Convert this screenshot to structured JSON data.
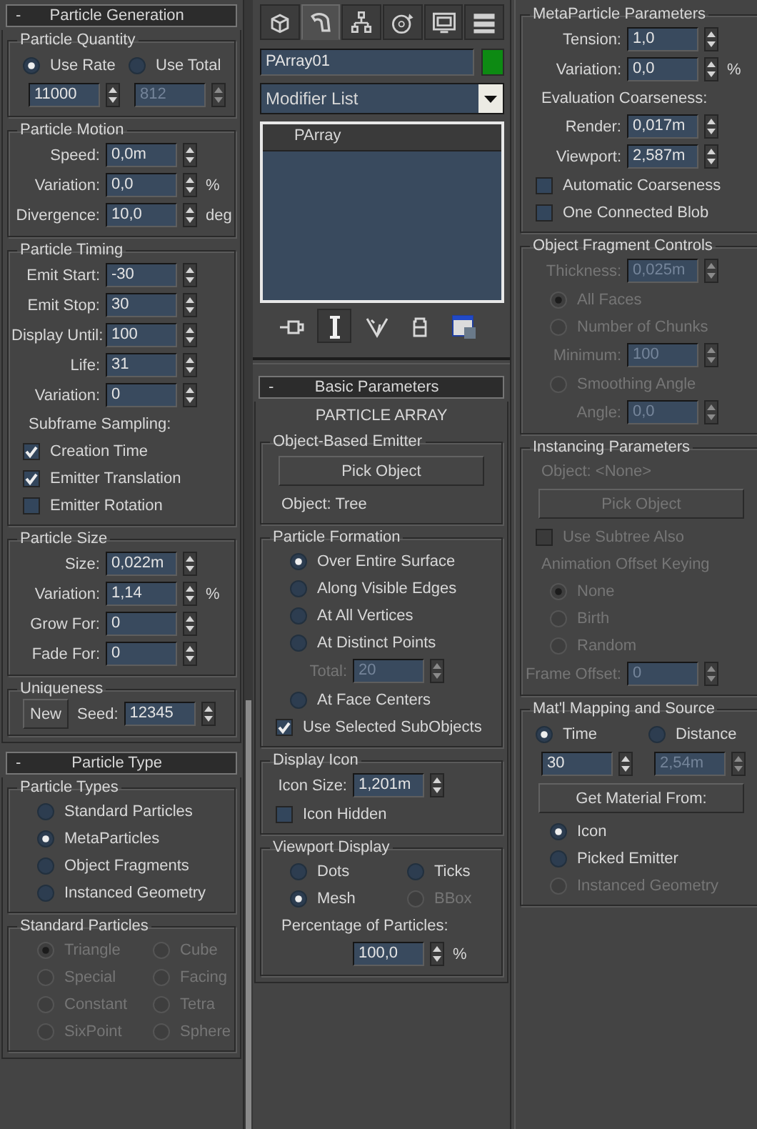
{
  "left_panel": {
    "rollouts": [
      {
        "toggle": "-",
        "title": "Particle Generation",
        "groups": [
          {
            "title": "Particle Quantity",
            "rows": [
              {
                "kind": "row",
                "items": [
                  {
                    "kind": "radio",
                    "label": "Use Rate",
                    "selected": true,
                    "disabled": false
                  },
                  {
                    "kind": "radio",
                    "label": "Use Total",
                    "selected": false,
                    "disabled": false
                  }
                ]
              },
              {
                "kind": "row",
                "items": [
                  {
                    "kind": "spinner",
                    "value": "11000",
                    "disabled": false
                  },
                  {
                    "kind": "spinner",
                    "value": "812",
                    "disabled": true
                  }
                ]
              }
            ]
          },
          {
            "title": "Particle Motion",
            "rows": [
              {
                "kind": "spinner",
                "label": "Speed:",
                "value": "0,0m",
                "disabled": false
              },
              {
                "kind": "spinner",
                "label": "Variation:",
                "value": "0,0",
                "unit": "%",
                "disabled": false
              },
              {
                "kind": "spinner",
                "label": "Divergence:",
                "value": "10,0",
                "unit": "deg",
                "disabled": false
              }
            ]
          },
          {
            "title": "Particle Timing",
            "rows": [
              {
                "kind": "spinner",
                "label": "Emit Start:",
                "value": "-30",
                "disabled": false
              },
              {
                "kind": "spinner",
                "label": "Emit Stop:",
                "value": "30",
                "disabled": false
              },
              {
                "kind": "spinner",
                "label": "Display Until:",
                "value": "100",
                "disabled": false
              },
              {
                "kind": "spinner",
                "label": "Life:",
                "value": "31",
                "disabled": false
              },
              {
                "kind": "spinner",
                "label": "Variation:",
                "value": "0",
                "disabled": false
              },
              {
                "kind": "note",
                "text": "Subframe Sampling:",
                "disabled": false
              },
              {
                "kind": "check",
                "label": "Creation Time",
                "checked": true,
                "disabled": false
              },
              {
                "kind": "check",
                "label": "Emitter Translation",
                "checked": true,
                "disabled": false
              },
              {
                "kind": "check",
                "label": "Emitter Rotation",
                "checked": false,
                "disabled": false
              }
            ]
          },
          {
            "title": "Particle Size",
            "rows": [
              {
                "kind": "spinner",
                "label": "Size:",
                "value": "0,022m",
                "disabled": false
              },
              {
                "kind": "spinner",
                "label": "Variation:",
                "value": "1,14",
                "unit": "%",
                "disabled": false
              },
              {
                "kind": "spinner",
                "label": "Grow For:",
                "value": "0",
                "disabled": false
              },
              {
                "kind": "spinner",
                "label": "Fade For:",
                "value": "0",
                "disabled": false
              }
            ]
          },
          {
            "title": "Uniqueness",
            "rows": [
              {
                "kind": "row",
                "items": [
                  {
                    "kind": "button",
                    "label": "New",
                    "disabled": false
                  },
                  {
                    "kind": "spinner",
                    "label": "Seed:",
                    "value": "12345",
                    "disabled": false
                  }
                ]
              }
            ]
          }
        ]
      },
      {
        "toggle": "-",
        "title": "Particle Type",
        "groups": [
          {
            "title": "Particle Types",
            "rows": [
              {
                "kind": "radio",
                "label": "Standard Particles",
                "selected": false,
                "disabled": false
              },
              {
                "kind": "radio",
                "label": "MetaParticles",
                "selected": true,
                "disabled": false
              },
              {
                "kind": "radio",
                "label": "Object Fragments",
                "selected": false,
                "disabled": false
              },
              {
                "kind": "radio",
                "label": "Instanced Geometry",
                "selected": false,
                "disabled": false
              }
            ]
          },
          {
            "title": "Standard Particles",
            "rows": [
              {
                "kind": "grid",
                "items": [
                  {
                    "kind": "radio",
                    "label": "Triangle",
                    "selected": true,
                    "disabled": true
                  },
                  {
                    "kind": "radio",
                    "label": "Cube",
                    "selected": false,
                    "disabled": true
                  },
                  {
                    "kind": "radio",
                    "label": "Special",
                    "selected": false,
                    "disabled": true
                  },
                  {
                    "kind": "radio",
                    "label": "Facing",
                    "selected": false,
                    "disabled": true
                  },
                  {
                    "kind": "radio",
                    "label": "Constant",
                    "selected": false,
                    "disabled": true
                  },
                  {
                    "kind": "radio",
                    "label": "Tetra",
                    "selected": false,
                    "disabled": true
                  },
                  {
                    "kind": "radio",
                    "label": "SixPoint",
                    "selected": false,
                    "disabled": true
                  },
                  {
                    "kind": "radio",
                    "label": "Sphere",
                    "selected": false,
                    "disabled": true
                  }
                ]
              }
            ]
          }
        ]
      }
    ]
  },
  "command_tabs": [
    {
      "selected": false
    },
    {
      "selected": true
    },
    {
      "selected": false
    },
    {
      "selected": false
    },
    {
      "selected": false
    },
    {
      "selected": false
    }
  ],
  "object_name": "PArray01",
  "modifier_list": "Modifier List",
  "modifier_stack": [
    {
      "label": "PArray",
      "selected": true
    }
  ],
  "stack_toolbar": [
    {
      "on": false
    },
    {
      "on": true
    },
    {
      "on": false
    },
    {
      "on": false
    },
    {
      "on": false
    }
  ],
  "middle_panel": {
    "rollouts": [
      {
        "toggle": "-",
        "title": "Basic Parameters",
        "heading": "PARTICLE ARRAY",
        "groups": [
          {
            "title": "Object-Based Emitter",
            "rows": [
              {
                "kind": "button",
                "label": "Pick Object",
                "disabled": false
              },
              {
                "kind": "note",
                "text": "Object: Tree",
                "disabled": false
              }
            ]
          },
          {
            "title": "Particle Formation",
            "rows": [
              {
                "kind": "radio",
                "label": "Over Entire Surface",
                "selected": true,
                "disabled": false
              },
              {
                "kind": "radio",
                "label": "Along Visible Edges",
                "selected": false,
                "disabled": false
              },
              {
                "kind": "radio",
                "label": "At All Vertices",
                "selected": false,
                "disabled": false
              },
              {
                "kind": "radio",
                "label": "At Distinct Points",
                "selected": false,
                "disabled": false
              },
              {
                "kind": "spinner",
                "label": "Total:",
                "value": "20",
                "disabled": true
              },
              {
                "kind": "radio",
                "label": "At Face Centers",
                "selected": false,
                "disabled": false
              },
              {
                "kind": "check",
                "label": "Use Selected SubObjects",
                "checked": true,
                "disabled": false
              }
            ]
          },
          {
            "title": "Display Icon",
            "rows": [
              {
                "kind": "spinner",
                "label": "Icon Size:",
                "value": "1,201m",
                "disabled": false
              },
              {
                "kind": "check",
                "label": "Icon Hidden",
                "checked": false,
                "disabled": false
              }
            ]
          },
          {
            "title": "Viewport Display",
            "rows": [
              {
                "kind": "grid",
                "items": [
                  {
                    "kind": "radio",
                    "label": "Dots",
                    "selected": false,
                    "disabled": false
                  },
                  {
                    "kind": "radio",
                    "label": "Ticks",
                    "selected": false,
                    "disabled": false
                  },
                  {
                    "kind": "radio",
                    "label": "Mesh",
                    "selected": true,
                    "disabled": false
                  },
                  {
                    "kind": "radio",
                    "label": "BBox",
                    "selected": false,
                    "disabled": true
                  }
                ]
              },
              {
                "kind": "note",
                "text": "Percentage of Particles:",
                "disabled": false
              },
              {
                "kind": "spinner",
                "value": "100,0",
                "unit": "%",
                "disabled": false
              }
            ]
          }
        ]
      }
    ]
  },
  "right_panel": {
    "groups": [
      {
        "title": "MetaParticle Parameters",
        "rows": [
          {
            "kind": "spinner",
            "label": "Tension:",
            "value": "1,0",
            "disabled": false
          },
          {
            "kind": "spinner",
            "label": "Variation:",
            "value": "0,0",
            "unit": "%",
            "disabled": false
          },
          {
            "kind": "note",
            "text": "Evaluation Coarseness:",
            "disabled": false
          },
          {
            "kind": "spinner",
            "label": "Render:",
            "value": "0,017m",
            "disabled": false
          },
          {
            "kind": "spinner",
            "label": "Viewport:",
            "value": "2,587m",
            "disabled": false
          },
          {
            "kind": "check",
            "label": "Automatic Coarseness",
            "checked": false,
            "disabled": false
          },
          {
            "kind": "check",
            "label": "One Connected Blob",
            "checked": false,
            "disabled": false
          }
        ]
      },
      {
        "title": "Object Fragment Controls",
        "rows": [
          {
            "kind": "spinner",
            "label": "Thickness:",
            "value": "0,025m",
            "disabled": true
          },
          {
            "kind": "radio",
            "label": "All Faces",
            "selected": true,
            "disabled": true
          },
          {
            "kind": "radio",
            "label": "Number of Chunks",
            "selected": false,
            "disabled": true
          },
          {
            "kind": "spinner",
            "label": "Minimum:",
            "value": "100",
            "disabled": true
          },
          {
            "kind": "radio",
            "label": "Smoothing Angle",
            "selected": false,
            "disabled": true
          },
          {
            "kind": "spinner",
            "label": "Angle:",
            "value": "0,0",
            "disabled": true
          }
        ]
      },
      {
        "title": "Instancing Parameters",
        "rows": [
          {
            "kind": "note",
            "text": "Object: <None>",
            "disabled": true
          },
          {
            "kind": "button",
            "label": "Pick Object",
            "disabled": true
          },
          {
            "kind": "check",
            "label": "Use Subtree Also",
            "checked": false,
            "disabled": true
          },
          {
            "kind": "note",
            "text": "Animation Offset Keying",
            "disabled": true
          },
          {
            "kind": "radio",
            "label": "None",
            "selected": true,
            "disabled": true
          },
          {
            "kind": "radio",
            "label": "Birth",
            "selected": false,
            "disabled": true
          },
          {
            "kind": "radio",
            "label": "Random",
            "selected": false,
            "disabled": true
          },
          {
            "kind": "spinner",
            "label": "Frame Offset:",
            "value": "0",
            "disabled": true
          }
        ]
      },
      {
        "title": "Mat'l Mapping and Source",
        "rows": [
          {
            "kind": "row",
            "items": [
              {
                "kind": "radio",
                "label": "Time",
                "selected": true,
                "disabled": false
              },
              {
                "kind": "radio",
                "label": "Distance",
                "selected": false,
                "disabled": false
              }
            ]
          },
          {
            "kind": "row",
            "items": [
              {
                "kind": "spinner",
                "value": "30",
                "disabled": false
              },
              {
                "kind": "spinner",
                "value": "2,54m",
                "disabled": true
              }
            ]
          },
          {
            "kind": "button",
            "label": "Get Material From:",
            "disabled": false
          },
          {
            "kind": "radio",
            "label": "Icon",
            "selected": true,
            "disabled": false
          },
          {
            "kind": "radio",
            "label": "Picked Emitter",
            "selected": false,
            "disabled": false
          },
          {
            "kind": "radio",
            "label": "Instanced Geometry",
            "selected": false,
            "disabled": true
          }
        ]
      }
    ]
  }
}
